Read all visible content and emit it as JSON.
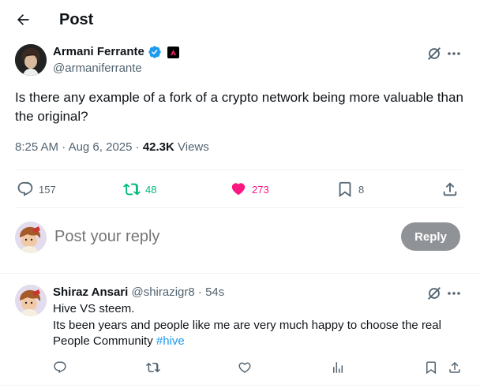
{
  "header": {
    "title": "Post"
  },
  "post": {
    "author_name": "Armani Ferrante",
    "author_handle": "@armaniferrante",
    "text": "Is there any example of a fork of a crypto network being more valuable than the original?",
    "time": "8:25 AM",
    "separator": "·",
    "date": "Aug 6, 2025",
    "views": "42.3K",
    "views_label": "Views",
    "actions": {
      "replies": "157",
      "reposts": "48",
      "likes": "273",
      "bookmarks": "8"
    },
    "colors": {
      "repost": "#00ba7c",
      "like": "#f91880"
    }
  },
  "composer": {
    "placeholder": "Post your reply",
    "button_label": "Reply"
  },
  "reply": {
    "author_name": "Shiraz Ansari",
    "author_handle": "@shirazigr8",
    "time": "54s",
    "separator": "·",
    "line1": "Hive VS steem.",
    "line2": "Its been years and people like me are very much happy to choose the real",
    "line3": "People Community ",
    "hashtag": "#hive"
  },
  "icons": {
    "back": "arrow-left-icon",
    "verified": "verified-badge-icon",
    "grok": "grok-icon",
    "more": "more-icon",
    "reply": "reply-icon",
    "repost": "repost-icon",
    "like": "heart-icon",
    "bookmark": "bookmark-icon",
    "share": "share-icon",
    "views": "views-icon"
  }
}
